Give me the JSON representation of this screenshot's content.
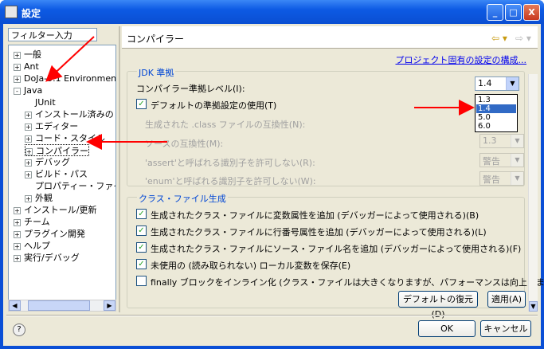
{
  "window": {
    "title": "設定",
    "minimize": "_",
    "maximize": "□",
    "close": "X"
  },
  "filter": {
    "placeholder": "フィルター入力",
    "value": "フィルター入力"
  },
  "tree": [
    {
      "label": "一般",
      "expander": "+"
    },
    {
      "label": "Ant",
      "expander": "+"
    },
    {
      "label": "DoJa-5.1 Environment",
      "expander": "+"
    },
    {
      "label": "Java",
      "expander": "-"
    },
    {
      "label": "JUnit",
      "expander": ""
    },
    {
      "label": "インストール済みの J",
      "expander": "+"
    },
    {
      "label": "エディター",
      "expander": "+"
    },
    {
      "label": "コード・スタイル",
      "expander": "+"
    },
    {
      "label": "コンパイラー",
      "expander": "+"
    },
    {
      "label": "デバッグ",
      "expander": "+"
    },
    {
      "label": "ビルド・パス",
      "expander": "+"
    },
    {
      "label": "プロパティー・ファイル・",
      "expander": ""
    },
    {
      "label": "外観",
      "expander": "+"
    },
    {
      "label": "インストール/更新",
      "expander": "+"
    },
    {
      "label": "チーム",
      "expander": "+"
    },
    {
      "label": "プラグイン開発",
      "expander": "+"
    },
    {
      "label": "ヘルプ",
      "expander": "+"
    },
    {
      "label": "実行/デバッグ",
      "expander": "+"
    }
  ],
  "page": {
    "title": "コンパイラー",
    "back_icon": "⇦ ▾",
    "forward_icon": "⇨ ▾",
    "project_link": "プロジェクト固有の設定の構成..."
  },
  "jdk": {
    "group_label": "JDK 準拠",
    "level_label": "コンパイラー準拠レベル(I):",
    "level_value": "1.4",
    "use_default_label": "デフォルトの準拠設定の使用(T)",
    "use_default_checked": "✓",
    "generated_label": "生成された .class ファイルの互換性(N):",
    "source_label": "ソースの互換性(M):",
    "source_value": "1.3",
    "assert_label": "'assert'と呼ばれる識別子を許可しない(R):",
    "assert_value": "警告",
    "enum_label": "'enum'と呼ばれる識別子を許可しない(W):",
    "enum_value": "警告",
    "dropdown_options": [
      "1.3",
      "1.4",
      "5.0",
      "6.0"
    ],
    "dropdown_selected": "1.4"
  },
  "classgen": {
    "group_label": "クラス・ファイル生成",
    "options": [
      {
        "label": "生成されたクラス・ファイルに変数属性を追加 (デバッガーによって使用される)(B)",
        "mark": "✓"
      },
      {
        "label": "生成されたクラス・ファイルに行番号属性を追加 (デバッガーによって使用される)(L)",
        "mark": "✓"
      },
      {
        "label": "生成されたクラス・ファイルにソース・ファイル名を追加 (デバッガーによって使用される)(F)",
        "mark": "✓"
      },
      {
        "label": "未使用の (読み取られない) ローカル変数を保存(E)",
        "mark": "✓"
      },
      {
        "label": "finally ブロックをインライン化 (クラス・ファイルは大きくなりますが、パフォーマンスは向上します)(O)",
        "mark": ""
      }
    ]
  },
  "buttons": {
    "restore": "デフォルトの復元(D)",
    "apply": "適用(A)",
    "ok": "OK",
    "cancel": "キャンセル",
    "help": "?"
  },
  "colors": {
    "annotation_arrow": "#ff0000",
    "titlebar": "#0a4ed2",
    "link": "#0000ee",
    "group_label": "#0046d5"
  }
}
